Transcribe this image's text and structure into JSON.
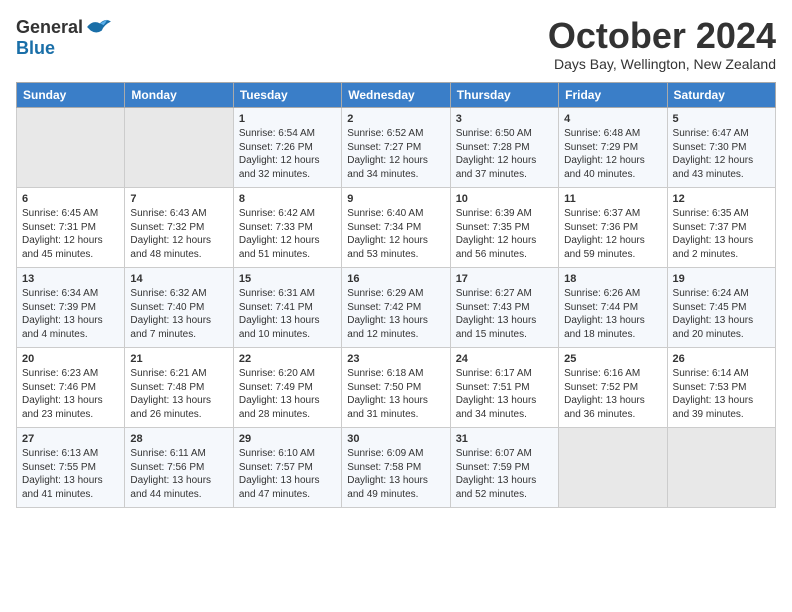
{
  "logo": {
    "general": "General",
    "blue": "Blue"
  },
  "title": {
    "month": "October 2024",
    "location": "Days Bay, Wellington, New Zealand"
  },
  "calendar": {
    "headers": [
      "Sunday",
      "Monday",
      "Tuesday",
      "Wednesday",
      "Thursday",
      "Friday",
      "Saturday"
    ],
    "weeks": [
      [
        {
          "day": "",
          "empty": true
        },
        {
          "day": "",
          "empty": true
        },
        {
          "day": "1",
          "sunrise": "6:54 AM",
          "sunset": "7:26 PM",
          "daylight": "12 hours and 32 minutes."
        },
        {
          "day": "2",
          "sunrise": "6:52 AM",
          "sunset": "7:27 PM",
          "daylight": "12 hours and 34 minutes."
        },
        {
          "day": "3",
          "sunrise": "6:50 AM",
          "sunset": "7:28 PM",
          "daylight": "12 hours and 37 minutes."
        },
        {
          "day": "4",
          "sunrise": "6:48 AM",
          "sunset": "7:29 PM",
          "daylight": "12 hours and 40 minutes."
        },
        {
          "day": "5",
          "sunrise": "6:47 AM",
          "sunset": "7:30 PM",
          "daylight": "12 hours and 43 minutes."
        }
      ],
      [
        {
          "day": "6",
          "sunrise": "6:45 AM",
          "sunset": "7:31 PM",
          "daylight": "12 hours and 45 minutes."
        },
        {
          "day": "7",
          "sunrise": "6:43 AM",
          "sunset": "7:32 PM",
          "daylight": "12 hours and 48 minutes."
        },
        {
          "day": "8",
          "sunrise": "6:42 AM",
          "sunset": "7:33 PM",
          "daylight": "12 hours and 51 minutes."
        },
        {
          "day": "9",
          "sunrise": "6:40 AM",
          "sunset": "7:34 PM",
          "daylight": "12 hours and 53 minutes."
        },
        {
          "day": "10",
          "sunrise": "6:39 AM",
          "sunset": "7:35 PM",
          "daylight": "12 hours and 56 minutes."
        },
        {
          "day": "11",
          "sunrise": "6:37 AM",
          "sunset": "7:36 PM",
          "daylight": "12 hours and 59 minutes."
        },
        {
          "day": "12",
          "sunrise": "6:35 AM",
          "sunset": "7:37 PM",
          "daylight": "13 hours and 2 minutes."
        }
      ],
      [
        {
          "day": "13",
          "sunrise": "6:34 AM",
          "sunset": "7:39 PM",
          "daylight": "13 hours and 4 minutes."
        },
        {
          "day": "14",
          "sunrise": "6:32 AM",
          "sunset": "7:40 PM",
          "daylight": "13 hours and 7 minutes."
        },
        {
          "day": "15",
          "sunrise": "6:31 AM",
          "sunset": "7:41 PM",
          "daylight": "13 hours and 10 minutes."
        },
        {
          "day": "16",
          "sunrise": "6:29 AM",
          "sunset": "7:42 PM",
          "daylight": "13 hours and 12 minutes."
        },
        {
          "day": "17",
          "sunrise": "6:27 AM",
          "sunset": "7:43 PM",
          "daylight": "13 hours and 15 minutes."
        },
        {
          "day": "18",
          "sunrise": "6:26 AM",
          "sunset": "7:44 PM",
          "daylight": "13 hours and 18 minutes."
        },
        {
          "day": "19",
          "sunrise": "6:24 AM",
          "sunset": "7:45 PM",
          "daylight": "13 hours and 20 minutes."
        }
      ],
      [
        {
          "day": "20",
          "sunrise": "6:23 AM",
          "sunset": "7:46 PM",
          "daylight": "13 hours and 23 minutes."
        },
        {
          "day": "21",
          "sunrise": "6:21 AM",
          "sunset": "7:48 PM",
          "daylight": "13 hours and 26 minutes."
        },
        {
          "day": "22",
          "sunrise": "6:20 AM",
          "sunset": "7:49 PM",
          "daylight": "13 hours and 28 minutes."
        },
        {
          "day": "23",
          "sunrise": "6:18 AM",
          "sunset": "7:50 PM",
          "daylight": "13 hours and 31 minutes."
        },
        {
          "day": "24",
          "sunrise": "6:17 AM",
          "sunset": "7:51 PM",
          "daylight": "13 hours and 34 minutes."
        },
        {
          "day": "25",
          "sunrise": "6:16 AM",
          "sunset": "7:52 PM",
          "daylight": "13 hours and 36 minutes."
        },
        {
          "day": "26",
          "sunrise": "6:14 AM",
          "sunset": "7:53 PM",
          "daylight": "13 hours and 39 minutes."
        }
      ],
      [
        {
          "day": "27",
          "sunrise": "6:13 AM",
          "sunset": "7:55 PM",
          "daylight": "13 hours and 41 minutes."
        },
        {
          "day": "28",
          "sunrise": "6:11 AM",
          "sunset": "7:56 PM",
          "daylight": "13 hours and 44 minutes."
        },
        {
          "day": "29",
          "sunrise": "6:10 AM",
          "sunset": "7:57 PM",
          "daylight": "13 hours and 47 minutes."
        },
        {
          "day": "30",
          "sunrise": "6:09 AM",
          "sunset": "7:58 PM",
          "daylight": "13 hours and 49 minutes."
        },
        {
          "day": "31",
          "sunrise": "6:07 AM",
          "sunset": "7:59 PM",
          "daylight": "13 hours and 52 minutes."
        },
        {
          "day": "",
          "empty": true
        },
        {
          "day": "",
          "empty": true
        }
      ]
    ]
  }
}
